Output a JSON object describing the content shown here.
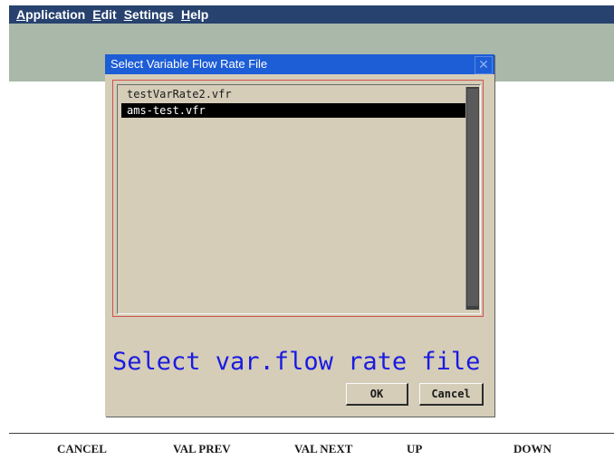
{
  "menubar": {
    "items": [
      {
        "mnemonic": "A",
        "rest": "pplication"
      },
      {
        "mnemonic": "E",
        "rest": "dit"
      },
      {
        "mnemonic": "S",
        "rest": "ettings"
      },
      {
        "mnemonic": "H",
        "rest": "elp"
      }
    ]
  },
  "dialog": {
    "title": "Select Variable Flow Rate File",
    "close_glyph": "✕",
    "files": [
      "testVarRate2.vfr",
      "ams-test.vfr"
    ],
    "selected_file": "ams-test.vfr",
    "prompt": "Select var.flow rate file",
    "ok_label": "OK",
    "cancel_label": "Cancel"
  },
  "fkeys": {
    "cancel": "CANCEL",
    "val_prev": "VAL PREV",
    "val_next": "VAL NEXT",
    "up": "UP",
    "down": "DOWN"
  },
  "colors": {
    "menubar": "#27426e",
    "toolbar": "#a9b8a8",
    "dialog_title": "#1d5dd6",
    "dialog_bg": "#d5cdb8",
    "prompt_text": "#1a1ae0"
  }
}
